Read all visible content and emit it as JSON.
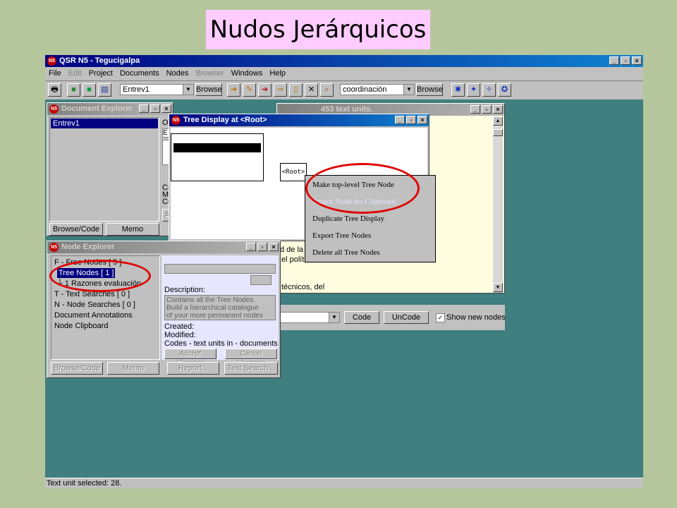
{
  "slide": {
    "title": "Nudos Jerárquicos"
  },
  "app": {
    "title": "QSR N5 - Tegucigalpa",
    "logo": "N5",
    "window_buttons": [
      "_",
      "▫",
      "×"
    ],
    "menu": [
      {
        "label": "File",
        "enabled": true
      },
      {
        "label": "Edit",
        "enabled": false
      },
      {
        "label": "Project",
        "enabled": true
      },
      {
        "label": "Documents",
        "enabled": true
      },
      {
        "label": "Nodes",
        "enabled": true
      },
      {
        "label": "Browser",
        "enabled": false
      },
      {
        "label": "Windows",
        "enabled": true
      },
      {
        "label": "Help",
        "enabled": true
      }
    ],
    "toolbar": {
      "document_combo": "Entrev1",
      "browse_label_1": "Browse",
      "node_combo": "coordinación",
      "browse_label_2": "Browse",
      "icons": [
        "print-icon",
        "document-icon",
        "document-green-icon",
        "clipboard-icon",
        "doc-arrow-icon",
        "doc-edit-icon",
        "doc-import-icon",
        "doc-export-icon",
        "doc-open-icon",
        "doc-delete-icon",
        "doc-search-icon",
        "node-icon",
        "node-tree-icon",
        "node-edit-icon",
        "node-search-icon"
      ]
    },
    "status_text": "Text unit selected: 28."
  },
  "doc_explorer": {
    "title": "Document Explorer",
    "items": [
      "Entrev1"
    ],
    "side_labels": [
      "Or",
      "E",
      "Cr",
      "Mc",
      "Co",
      "A"
    ],
    "browse_code_label": "Browse/Code",
    "memo_label": "Memo"
  },
  "doc_browser": {
    "title_fragment": "453 text units.",
    "text_lines": [
      "d de la",
      "el polít",
      "técnicos, del"
    ],
    "code_label": "Code",
    "uncode_label": "UnCode",
    "show_new_nodes_label": "Show new nodes",
    "show_new_nodes_checked": "✓"
  },
  "tree_display": {
    "title": "Tree Display at <Root>",
    "root_label": "<Root>"
  },
  "context_menu": {
    "items": [
      {
        "label": "Make top-level Tree Node",
        "enabled": true
      },
      {
        "label": "Attach Node fro Clipboard",
        "enabled": false
      },
      {
        "label": "Duplicate Tree Display",
        "enabled": true
      },
      {
        "label": "Export Tree Nodes",
        "enabled": true
      },
      {
        "label": "Delete all Tree Nodes",
        "enabled": true
      }
    ]
  },
  "node_explorer": {
    "title": "Node Explorer",
    "items": [
      {
        "label": "F - Free Nodes [ 5 ]",
        "selected": false
      },
      {
        "label": "Tree Nodes [ 1 ]",
        "selected": true
      },
      {
        "label": "└ 1   Razones evaluación",
        "selected": false
      },
      {
        "label": "T - Text Searches [ 0 ]",
        "selected": false
      },
      {
        "label": "N - Node Searches [ 0 ]",
        "selected": false
      },
      {
        "label": "Document Annotations",
        "selected": false
      },
      {
        "label": "Node Clipboard",
        "selected": false
      }
    ],
    "description_label": "Description:",
    "description_text": "Contains all the Tree Nodes.  Build a hierarchical catalogue of your more permanent nodes here.",
    "created_label": "Created:",
    "modified_label": "Modified:",
    "codes_label": "Codes - text units in - documents",
    "accept_label": "Accept Changes",
    "cancel_label": "Cancel Changes",
    "buttons": [
      "Browse/Code",
      "Memo",
      "Report...",
      "Text Search..."
    ]
  },
  "colors": {
    "desktop": "#3f7f7f",
    "slide_bg": "#b6c69c",
    "title_bg": "#ffccff",
    "highlight_ring": "#e00000",
    "selection": "#000080"
  }
}
